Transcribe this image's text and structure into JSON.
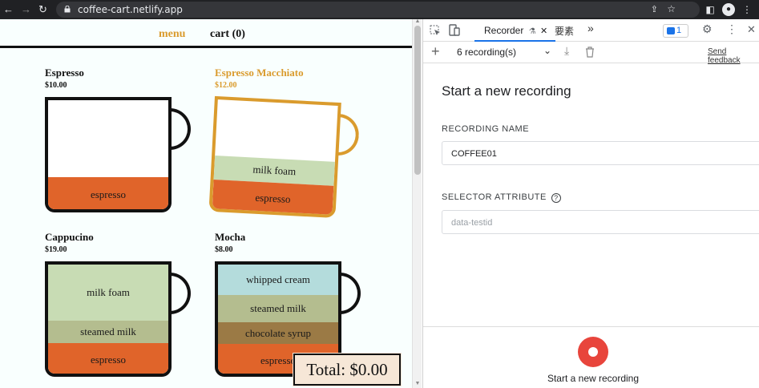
{
  "browser": {
    "url": "coffee-cart.netlify.app"
  },
  "page": {
    "nav": {
      "menu": "menu",
      "cart": "cart (0)"
    },
    "products": [
      {
        "name": "Espresso",
        "price": "$10.00",
        "layers": [
          "espresso"
        ]
      },
      {
        "name": "Espresso Macchiato",
        "price": "$12.00",
        "layers": [
          "milk foam",
          "espresso"
        ]
      },
      {
        "name": "Cappucino",
        "price": "$19.00",
        "layers": [
          "milk foam",
          "steamed milk",
          "espresso"
        ]
      },
      {
        "name": "Mocha",
        "price": "$8.00",
        "layers": [
          "whipped cream",
          "steamed milk",
          "chocolate syrup",
          "espresso"
        ]
      }
    ],
    "total": "Total: $0.00"
  },
  "devtools": {
    "tabs": {
      "recorder": "Recorder",
      "elements": "要素",
      "more": "»"
    },
    "issues_count": "1",
    "recordings_select": "6 recording(s)",
    "send_feedback": "Send feedback",
    "title": "Start a new recording",
    "recording_name_label": "RECORDING NAME",
    "recording_name_value": "COFFEE01",
    "selector_label": "SELECTOR ATTRIBUTE",
    "selector_placeholder": "data-testid",
    "start_caption": "Start a new recording"
  },
  "colors": {
    "espresso": "#e0642a",
    "milk_foam": "#c8dcb4",
    "steamed_milk": "#b4bd8f",
    "chocolate_syrup": "#9b7a45",
    "whipped_cream": "#b4dcdc",
    "accent": "#da9b2d",
    "record": "#e8453c"
  }
}
